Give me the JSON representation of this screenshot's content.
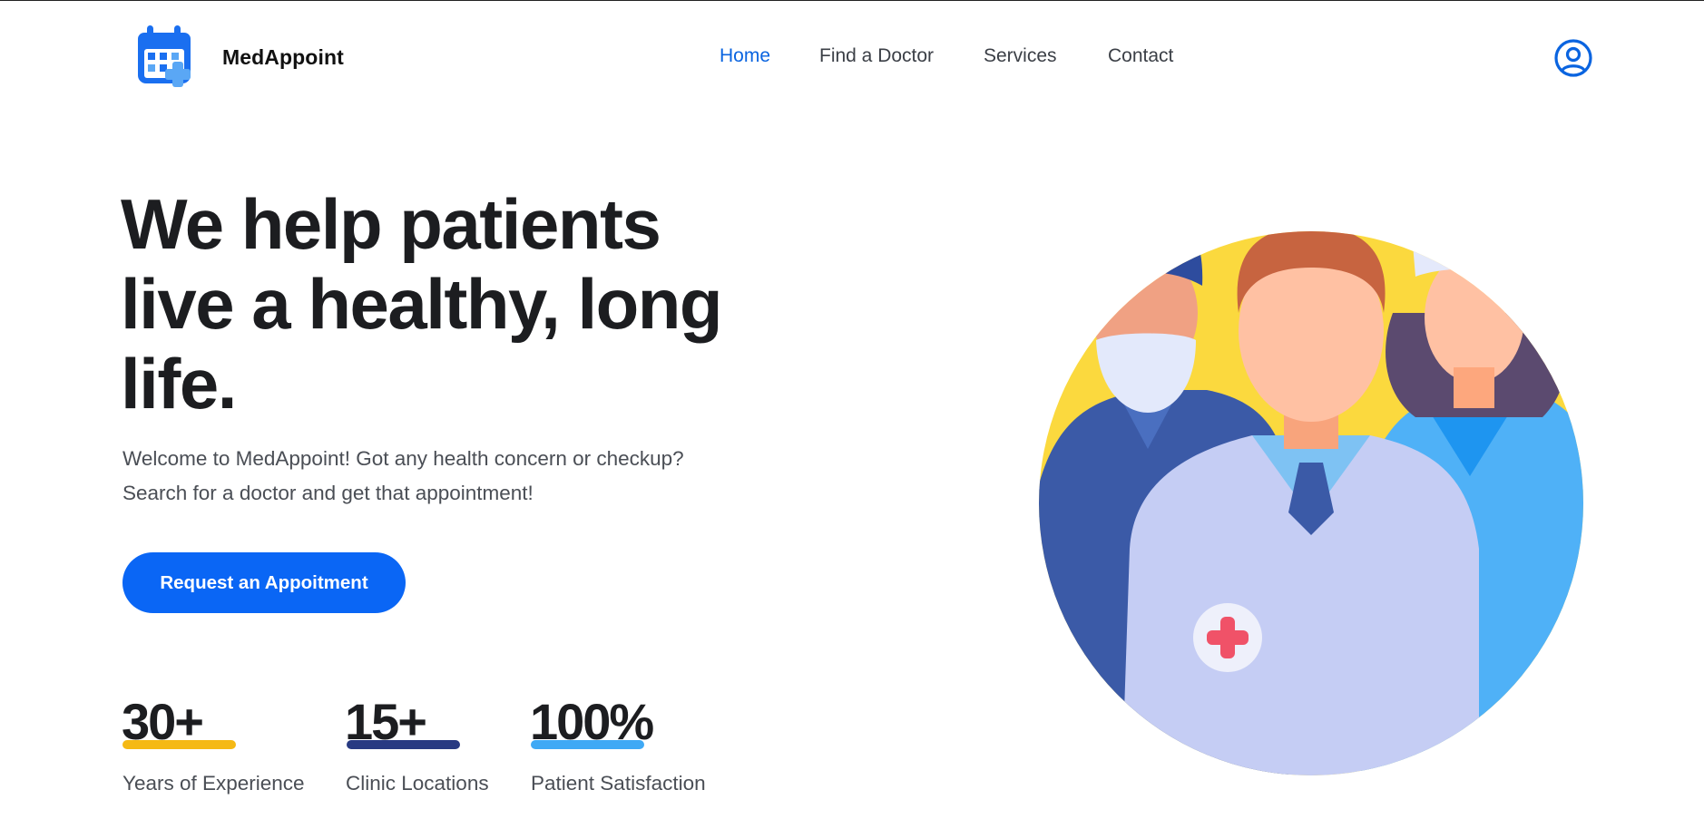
{
  "brand": {
    "name": "MedAppoint"
  },
  "nav": {
    "items": [
      {
        "label": "Home",
        "active": true
      },
      {
        "label": "Find a Doctor",
        "active": false
      },
      {
        "label": "Services",
        "active": false
      },
      {
        "label": "Contact",
        "active": false
      }
    ]
  },
  "hero": {
    "title": "We help patients live a healthy, long life.",
    "subtitle_line1": "Welcome to MedAppoint! Got any health concern or checkup?",
    "subtitle_line2": "Search for a doctor and get that appointment!",
    "cta_label": "Request an Appoitment"
  },
  "stats": [
    {
      "value": "30+",
      "label": "Years of Experience",
      "color": "#f5b914"
    },
    {
      "value": "15+",
      "label": "Clinic Locations",
      "color": "#283a82"
    },
    {
      "value": "100%",
      "label": "Patient Satisfaction",
      "color": "#3fa9f5"
    }
  ],
  "colors": {
    "accent": "#0a66f5",
    "nav_active": "#0a64e0",
    "text_dark": "#1c1d20",
    "text_muted": "#4a4e55"
  },
  "icons": {
    "logo": "calendar-plus-icon",
    "account": "user-circle-icon"
  }
}
